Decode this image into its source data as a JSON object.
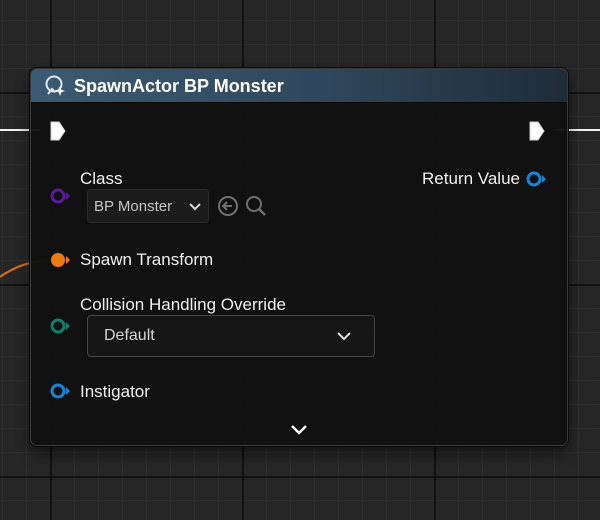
{
  "node": {
    "title": "SpawnActor BP Monster",
    "header_icon": "spawn-actor-icon",
    "pins": {
      "class": {
        "label": "Class",
        "value": "BP Monster",
        "color": "#5a1a9e"
      },
      "spawn_transform": {
        "label": "Spawn Transform",
        "color": "#f07a0e"
      },
      "collision_handling": {
        "label": "Collision Handling Override",
        "value": "Default",
        "color": "#0f7f6c"
      },
      "instigator": {
        "label": "Instigator",
        "color": "#1586d6"
      },
      "return_value": {
        "label": "Return Value",
        "color": "#1586d6"
      }
    },
    "class_buttons": [
      "use-selected-icon",
      "browse-icon"
    ],
    "advanced_toggle_icon": "chevron-down-icon"
  },
  "colors": {
    "header": "#3c5a73",
    "exec_pin": "#ffffff",
    "transform_wire": "#e07010"
  }
}
